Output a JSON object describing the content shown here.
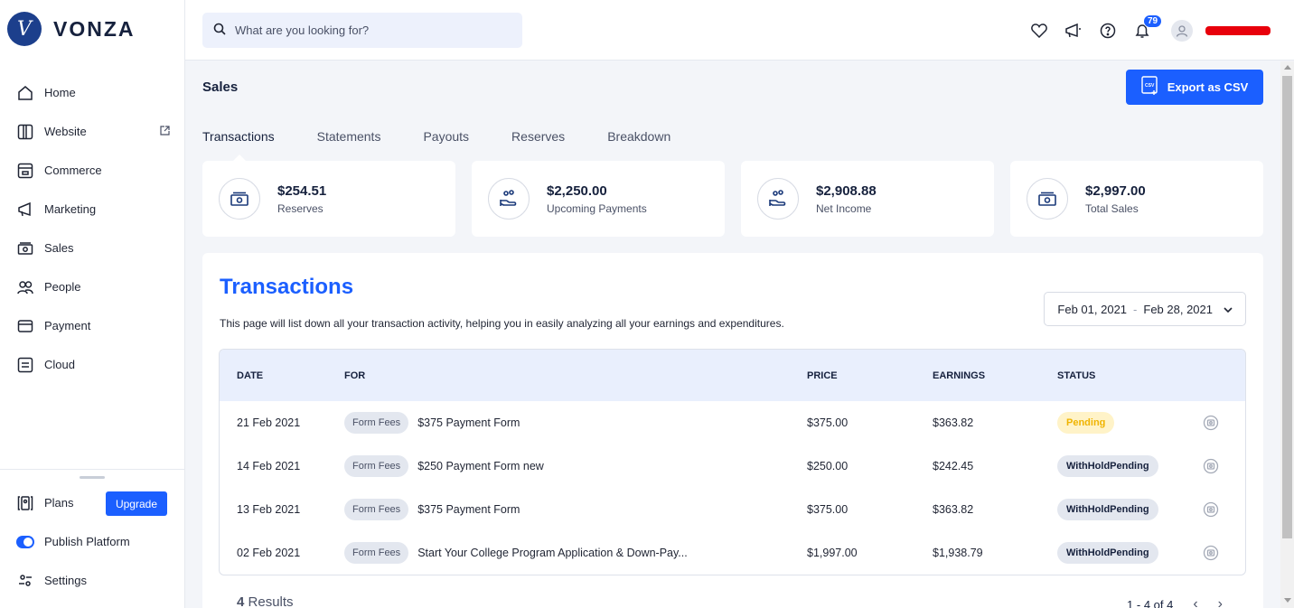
{
  "brand": {
    "name": "VONZA",
    "mark": "V"
  },
  "search": {
    "placeholder": "What are you looking for?"
  },
  "topbar": {
    "notification_count": "79"
  },
  "sidebar": {
    "items": [
      {
        "label": "Home",
        "icon": "home-icon"
      },
      {
        "label": "Website",
        "icon": "website-icon"
      },
      {
        "label": "Commerce",
        "icon": "commerce-icon"
      },
      {
        "label": "Marketing",
        "icon": "megaphone-icon"
      },
      {
        "label": "Sales",
        "icon": "cash-icon"
      },
      {
        "label": "People",
        "icon": "people-icon"
      },
      {
        "label": "Payment",
        "icon": "card-icon"
      },
      {
        "label": "Cloud",
        "icon": "cloud-icon"
      }
    ],
    "bottom": {
      "plans": "Plans",
      "upgrade": "Upgrade",
      "publish": "Publish Platform",
      "settings": "Settings"
    }
  },
  "page": {
    "title": "Sales",
    "export_label": "Export as CSV",
    "tabs": [
      "Transactions",
      "Statements",
      "Payouts",
      "Reserves",
      "Breakdown"
    ],
    "active_tab": "Transactions"
  },
  "stats": [
    {
      "value": "$254.51",
      "label": "Reserves",
      "icon": "cash-icon"
    },
    {
      "value": "$2,250.00",
      "label": "Upcoming Payments",
      "icon": "hand-coins-icon"
    },
    {
      "value": "$2,908.88",
      "label": "Net Income",
      "icon": "hand-coins-icon"
    },
    {
      "value": "$2,997.00",
      "label": "Total Sales",
      "icon": "cash-icon"
    }
  ],
  "transactions": {
    "title": "Transactions",
    "description": "This page will list down all your transaction activity, helping you in easily analyzing all your earnings and expenditures.",
    "date_from": "Feb 01, 2021",
    "date_sep": "-",
    "date_to": "Feb 28, 2021",
    "columns": [
      "DATE",
      "FOR",
      "PRICE",
      "EARNINGS",
      "STATUS"
    ],
    "rows": [
      {
        "date": "21 Feb 2021",
        "tag": "Form Fees",
        "for": "$375 Payment Form",
        "price": "$375.00",
        "earnings": "$363.82",
        "status": "Pending",
        "status_type": "pending"
      },
      {
        "date": "14 Feb 2021",
        "tag": "Form Fees",
        "for": "$250 Payment Form new",
        "price": "$250.00",
        "earnings": "$242.45",
        "status": "WithHoldPending",
        "status_type": "withhold"
      },
      {
        "date": "13 Feb 2021",
        "tag": "Form Fees",
        "for": "$375 Payment Form",
        "price": "$375.00",
        "earnings": "$363.82",
        "status": "WithHoldPending",
        "status_type": "withhold"
      },
      {
        "date": "02 Feb 2021",
        "tag": "Form Fees",
        "for": "Start Your College Program Application & Down-Pay...",
        "price": "$1,997.00",
        "earnings": "$1,938.79",
        "status": "WithHoldPending",
        "status_type": "withhold"
      }
    ],
    "results_count": "4",
    "results_label": "Results",
    "pager": "1 - 4 of 4"
  },
  "colors": {
    "accent": "#1b5fff",
    "pending": "#f0b400",
    "username_redacted": "#e8000b"
  }
}
